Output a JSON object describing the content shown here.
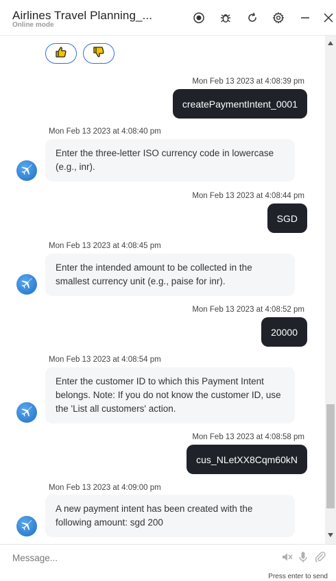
{
  "header": {
    "title": "Airlines Travel Planning_...",
    "subtitle": "Online mode",
    "icons": [
      "record-icon",
      "bug-icon",
      "refresh-icon",
      "settings-icon",
      "minimize-icon",
      "close-icon"
    ]
  },
  "feedback": {
    "icons": [
      "thumbs-up-icon",
      "thumbs-down-icon"
    ]
  },
  "messages": [
    {
      "sender": "user",
      "timestamp": "Mon Feb 13 2023 at 4:08:39 pm",
      "text": "createPaymentIntent_0001"
    },
    {
      "sender": "bot",
      "timestamp": "Mon Feb 13 2023 at 4:08:40 pm",
      "text": "Enter the three-letter ISO currency code in lowercase (e.g., inr)."
    },
    {
      "sender": "user",
      "timestamp": "Mon Feb 13 2023 at 4:08:44 pm",
      "text": "SGD"
    },
    {
      "sender": "bot",
      "timestamp": "Mon Feb 13 2023 at 4:08:45 pm",
      "text": "Enter the intended amount to be collected in the smallest currency unit (e.g., paise for inr)."
    },
    {
      "sender": "user",
      "timestamp": "Mon Feb 13 2023 at 4:08:52 pm",
      "text": "20000"
    },
    {
      "sender": "bot",
      "timestamp": "Mon Feb 13 2023 at 4:08:54 pm",
      "text": "Enter the customer ID to which this Payment Intent belongs. Note: If you do not know the customer ID, use the 'List all customers' action."
    },
    {
      "sender": "user",
      "timestamp": "Mon Feb 13 2023 at 4:08:58 pm",
      "text": "cus_NLetXX8Cqm60kN"
    },
    {
      "sender": "bot",
      "timestamp": "Mon Feb 13 2023 at 4:09:00 pm",
      "text": "A new payment intent has been created with the following amount: sgd 200"
    }
  ],
  "composer": {
    "placeholder": "Message...",
    "hint": "Press enter to send",
    "icons": [
      "speaker-mute-icon",
      "microphone-icon",
      "attachment-icon"
    ]
  },
  "colors": {
    "accent": "#2f6fd6",
    "user_bubble": "#1f2228",
    "bot_bubble": "#f5f6f8",
    "avatar": "#2f86e0"
  }
}
